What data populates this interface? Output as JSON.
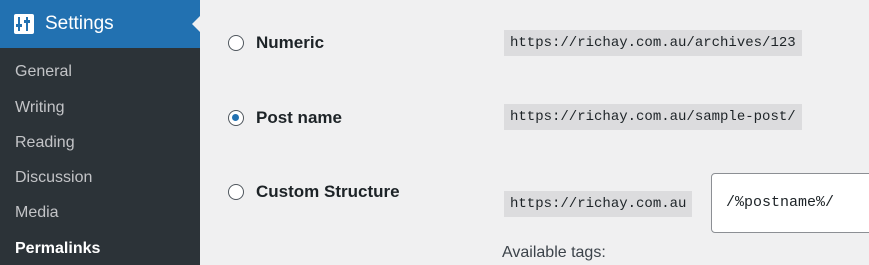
{
  "sidebar": {
    "title": "Settings",
    "items": [
      {
        "label": "General"
      },
      {
        "label": "Writing"
      },
      {
        "label": "Reading"
      },
      {
        "label": "Discussion"
      },
      {
        "label": "Media"
      },
      {
        "label": "Permalinks",
        "current": true
      }
    ]
  },
  "permalinks": {
    "options": [
      {
        "label": "Numeric",
        "example": "https://richay.com.au/archives/123",
        "checked": false
      },
      {
        "label": "Post name",
        "example": "https://richay.com.au/sample-post/",
        "checked": true
      },
      {
        "label": "Custom Structure",
        "example": "https://richay.com.au",
        "checked": false
      }
    ],
    "custom_value": "/%postname%/",
    "available_tags_label": "Available tags:"
  },
  "colors": {
    "sidebar_bg": "#1d2327",
    "submenu_bg": "#2c3338",
    "accent": "#2271b1",
    "page_bg": "#f0f0f1",
    "code_bg": "#dcdcde"
  },
  "icons": {
    "settings": "settings-sliders-icon"
  }
}
